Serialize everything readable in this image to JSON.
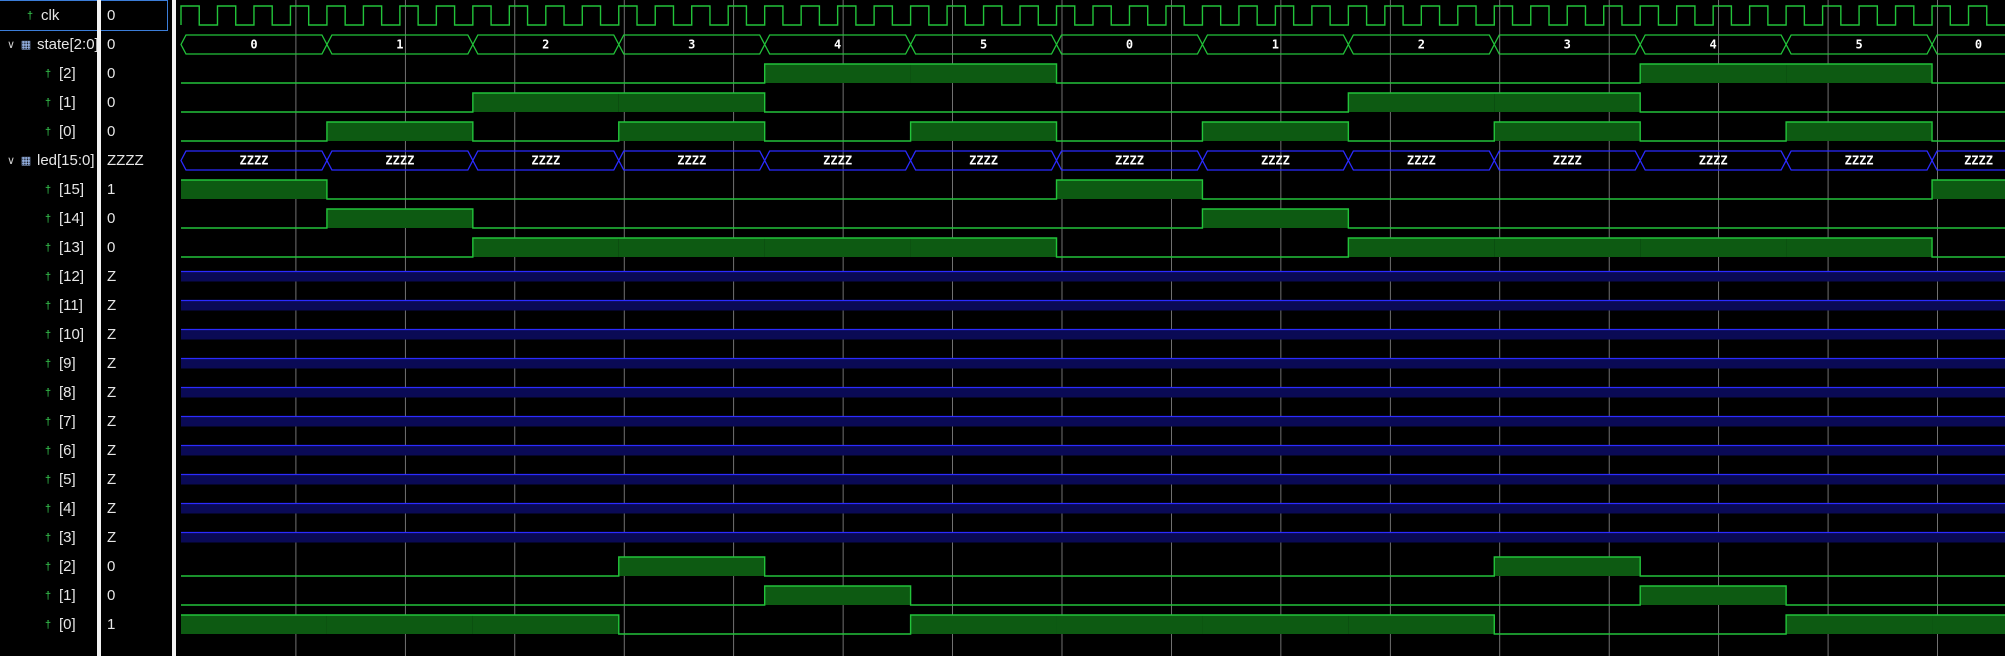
{
  "colors": {
    "wave": "#22c33a",
    "fill": "#0d5a12",
    "hiz": "#2b2bff",
    "hizFill": "#0a0a55",
    "grid": "#bdbdbd",
    "bg": "#000000"
  },
  "signals": [
    {
      "id": "clk",
      "name": "clk",
      "value": "0",
      "kind": "clock",
      "icon": "bit-signal-icon",
      "indent": 1,
      "expand": "",
      "selected": true
    },
    {
      "id": "state",
      "name": "state[2:0]",
      "value": "0",
      "kind": "bus",
      "icon": "bus-signal-icon",
      "indent": 0,
      "expand": "expanded"
    },
    {
      "id": "state2",
      "name": "[2]",
      "value": "0",
      "kind": "bit",
      "icon": "bit-signal-icon",
      "indent": 2,
      "expand": ""
    },
    {
      "id": "state1",
      "name": "[1]",
      "value": "0",
      "kind": "bit",
      "icon": "bit-signal-icon",
      "indent": 2,
      "expand": ""
    },
    {
      "id": "state0",
      "name": "[0]",
      "value": "0",
      "kind": "bit",
      "icon": "bit-signal-icon",
      "indent": 2,
      "expand": ""
    },
    {
      "id": "led",
      "name": "led[15:0]",
      "value": "ZZZZ",
      "kind": "bus",
      "icon": "bus-signal-icon",
      "indent": 0,
      "expand": "expanded"
    },
    {
      "id": "led15",
      "name": "[15]",
      "value": "1",
      "kind": "bit",
      "icon": "bit-signal-icon",
      "indent": 2,
      "expand": ""
    },
    {
      "id": "led14",
      "name": "[14]",
      "value": "0",
      "kind": "bit",
      "icon": "bit-signal-icon",
      "indent": 2,
      "expand": ""
    },
    {
      "id": "led13",
      "name": "[13]",
      "value": "0",
      "kind": "bit",
      "icon": "bit-signal-icon",
      "indent": 2,
      "expand": ""
    },
    {
      "id": "led12",
      "name": "[12]",
      "value": "Z",
      "kind": "hiz",
      "icon": "bit-signal-icon",
      "indent": 2,
      "expand": ""
    },
    {
      "id": "led11",
      "name": "[11]",
      "value": "Z",
      "kind": "hiz",
      "icon": "bit-signal-icon",
      "indent": 2,
      "expand": ""
    },
    {
      "id": "led10",
      "name": "[10]",
      "value": "Z",
      "kind": "hiz",
      "icon": "bit-signal-icon",
      "indent": 2,
      "expand": ""
    },
    {
      "id": "led9",
      "name": "[9]",
      "value": "Z",
      "kind": "hiz",
      "icon": "bit-signal-icon",
      "indent": 2,
      "expand": ""
    },
    {
      "id": "led8",
      "name": "[8]",
      "value": "Z",
      "kind": "hiz",
      "icon": "bit-signal-icon",
      "indent": 2,
      "expand": ""
    },
    {
      "id": "led7",
      "name": "[7]",
      "value": "Z",
      "kind": "hiz",
      "icon": "bit-signal-icon",
      "indent": 2,
      "expand": ""
    },
    {
      "id": "led6",
      "name": "[6]",
      "value": "Z",
      "kind": "hiz",
      "icon": "bit-signal-icon",
      "indent": 2,
      "expand": ""
    },
    {
      "id": "led5",
      "name": "[5]",
      "value": "Z",
      "kind": "hiz",
      "icon": "bit-signal-icon",
      "indent": 2,
      "expand": ""
    },
    {
      "id": "led4",
      "name": "[4]",
      "value": "Z",
      "kind": "hiz",
      "icon": "bit-signal-icon",
      "indent": 2,
      "expand": ""
    },
    {
      "id": "led3",
      "name": "[3]",
      "value": "Z",
      "kind": "hiz",
      "icon": "bit-signal-icon",
      "indent": 2,
      "expand": ""
    },
    {
      "id": "led2",
      "name": "[2]",
      "value": "0",
      "kind": "bit",
      "icon": "bit-signal-icon",
      "indent": 2,
      "expand": ""
    },
    {
      "id": "led1",
      "name": "[1]",
      "value": "0",
      "kind": "bit",
      "icon": "bit-signal-icon",
      "indent": 2,
      "expand": ""
    },
    {
      "id": "led0",
      "name": "[0]",
      "value": "1",
      "kind": "bit",
      "icon": "bit-signal-icon",
      "indent": 2,
      "expand": ""
    }
  ],
  "waveform": {
    "clock_cycles": 50,
    "state_labels": [
      "0",
      "1",
      "2",
      "3",
      "4",
      "5",
      "0",
      "1",
      "2",
      "3",
      "4",
      "5",
      "0"
    ],
    "led_bus_labels": [
      "ZZZZ",
      "ZZZZ",
      "ZZZZ",
      "ZZZZ",
      "ZZZZ",
      "ZZZZ",
      "ZZZZ",
      "ZZZZ",
      "ZZZZ",
      "ZZZZ",
      "ZZZZ",
      "ZZZZ",
      "ZZZZ"
    ],
    "bit_levels": {
      "state2": [
        0,
        0,
        0,
        0,
        1,
        1,
        0,
        0,
        0,
        0,
        1,
        1,
        0
      ],
      "state1": [
        0,
        0,
        1,
        1,
        0,
        0,
        0,
        0,
        1,
        1,
        0,
        0,
        0
      ],
      "state0": [
        0,
        1,
        0,
        1,
        0,
        1,
        0,
        1,
        0,
        1,
        0,
        1,
        0
      ],
      "led15": [
        1,
        0,
        0,
        0,
        0,
        0,
        1,
        0,
        0,
        0,
        0,
        0,
        1
      ],
      "led14": [
        0,
        1,
        0,
        0,
        0,
        0,
        0,
        1,
        0,
        0,
        0,
        0,
        0
      ],
      "led13": [
        0,
        0,
        1,
        1,
        1,
        1,
        0,
        0,
        1,
        1,
        1,
        1,
        0
      ],
      "led2": [
        0,
        0,
        0,
        1,
        0,
        0,
        0,
        0,
        0,
        1,
        0,
        0,
        0
      ],
      "led1": [
        0,
        0,
        0,
        0,
        1,
        0,
        0,
        0,
        0,
        0,
        1,
        0,
        0
      ],
      "led0": [
        1,
        1,
        1,
        0,
        0,
        1,
        1,
        1,
        1,
        0,
        0,
        1,
        1
      ]
    }
  }
}
